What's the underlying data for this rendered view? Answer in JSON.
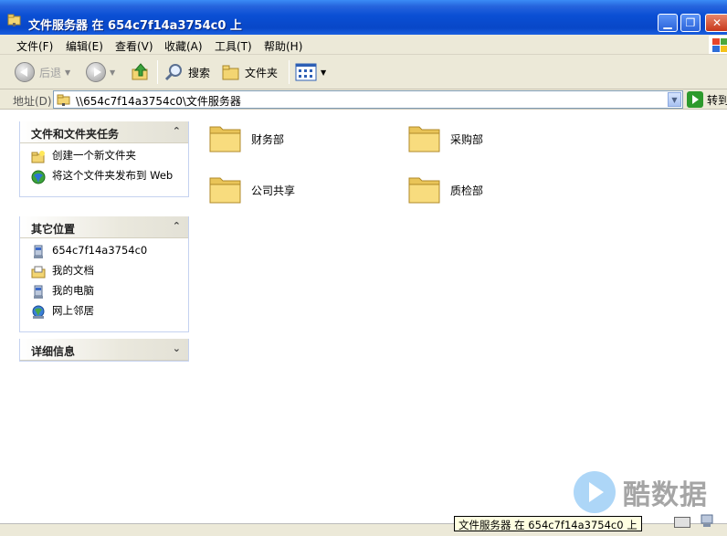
{
  "window": {
    "title": "文件服务器 在 654c7f14a3754c0 上"
  },
  "menu": [
    "文件(F)",
    "编辑(E)",
    "查看(V)",
    "收藏(A)",
    "工具(T)",
    "帮助(H)"
  ],
  "toolbar": {
    "back_label": "后退",
    "search_label": "搜索",
    "folders_label": "文件夹"
  },
  "address": {
    "label": "地址(D)",
    "value": "\\\\654c7f14a3754c0\\文件服务器",
    "go_label": "转到"
  },
  "panels": {
    "tasks": {
      "title": "文件和文件夹任务",
      "items": [
        "创建一个新文件夹",
        "将这个文件夹发布到 Web"
      ]
    },
    "places": {
      "title": "其它位置",
      "items": [
        "654c7f14a3754c0",
        "我的文档",
        "我的电脑",
        "网上邻居"
      ]
    },
    "details": {
      "title": "详细信息"
    }
  },
  "folders": [
    "财务部",
    "采购部",
    "公司共享",
    "质检部"
  ],
  "tooltip": "文件服务器 在 654c7f14a3754c0 上",
  "watermark": "酷数据"
}
